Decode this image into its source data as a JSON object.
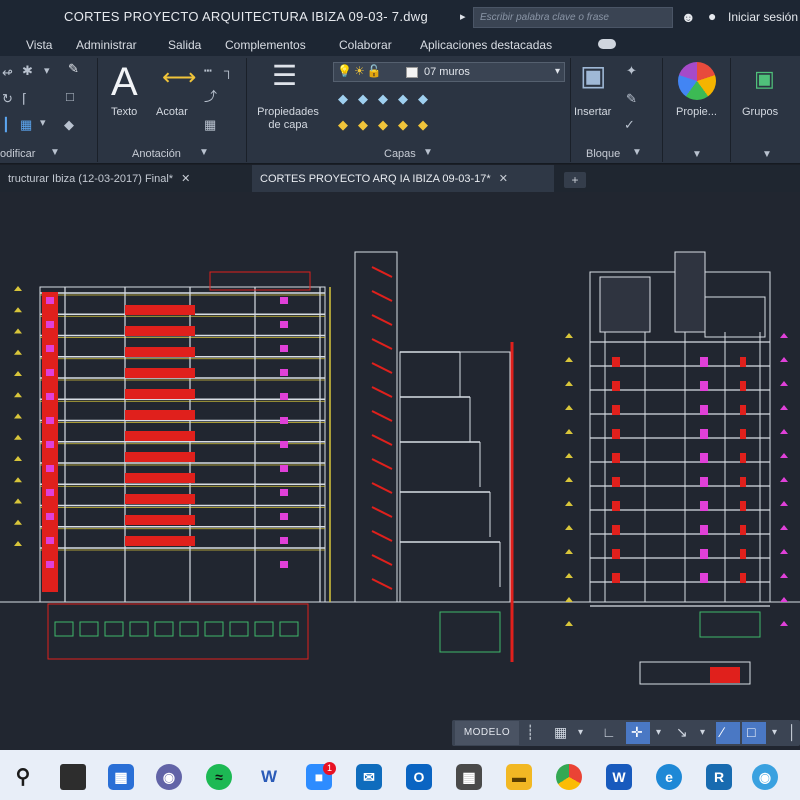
{
  "window": {
    "title": "CORTES PROYECTO ARQUITECTURA IBIZA  09-03-  7.dwg",
    "search_placeholder": "Escribir palabra clave o frase",
    "sign_in": "Iniciar sesión"
  },
  "menu": {
    "items": [
      "Vista",
      "Administrar",
      "Salida",
      "Complementos",
      "Colaborar",
      "Aplicaciones destacadas"
    ]
  },
  "ribbon": {
    "panels": {
      "modify_label": "odificar",
      "annotation_label": "Anotación",
      "layers_label": "Capas",
      "block_label": "Bloque"
    },
    "buttons": {
      "text_label": "Texto",
      "dimension_label": "Acotar",
      "layer_properties_label": "Propiedades de capa",
      "insert_label": "Insertar",
      "properties_label": "Propie...",
      "groups_label": "Grupos"
    },
    "layer_current": "07 muros"
  },
  "tabs": [
    {
      "label": "tructurar Ibiza (12-03-2017)  Final*",
      "active": false
    },
    {
      "label": "CORTES PROYECTO ARQ IA IBIZA 09-03-17*",
      "active": true
    }
  ],
  "status": {
    "model_label": "MODELO"
  },
  "taskbar": {
    "badge_count": "1",
    "apps": [
      "search-icon",
      "task-view-icon",
      "widgets-icon",
      "teams-icon",
      "spotify-icon",
      "word-w-icon",
      "zoom-icon",
      "mail-icon",
      "outlook-icon",
      "calculator-icon",
      "file-explorer-icon",
      "chrome-icon",
      "word-icon",
      "edge-icon",
      "revit-icon",
      "maps-icon"
    ]
  },
  "colors": {
    "canvas": "#212630",
    "ribbon": "#2b3442",
    "titlebar": "#1d2633",
    "cad_red": "#e0201c",
    "cad_yellow": "#d8c53a",
    "cad_magenta": "#e040d8",
    "cad_white": "#d8dde4",
    "accent": "#4a78c4"
  }
}
